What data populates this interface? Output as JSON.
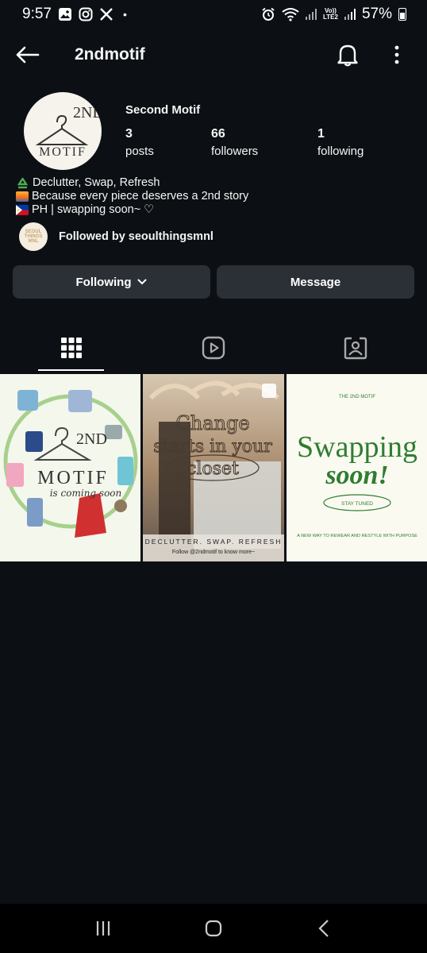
{
  "status_bar": {
    "time": "9:57",
    "dot": "•",
    "battery": "57%",
    "vo_label": "Vo))",
    "lte_label": "LTE2"
  },
  "header": {
    "username": "2ndmotif"
  },
  "profile": {
    "avatar_text": {
      "top": "2ND",
      "bottom": "MOTIF"
    },
    "display_name": "Second Motif",
    "stats": [
      {
        "num": "3",
        "label": "posts"
      },
      {
        "num": "66",
        "label": "followers"
      },
      {
        "num": "1",
        "label": "following"
      }
    ],
    "bio": [
      "Declutter, Swap, Refresh",
      "Because every piece deserves a 2nd story",
      "PH | swapping soon~ ♡"
    ],
    "followed_by": "Followed by seoulthingsmnl",
    "follower_avatar_text": "SEOUL THINGS MNL"
  },
  "buttons": {
    "following": "Following",
    "message": "Message"
  },
  "tabs": [
    "grid-icon",
    "reels-icon",
    "tagged-icon"
  ],
  "posts": [
    {
      "title_top": "2ND",
      "title_main": "MOTIF",
      "subtitle": "is coming soon"
    },
    {
      "headline": [
        "Change",
        "starts in your",
        "closet"
      ],
      "tagline": "DECLUTTER. SWAP. REFRESH",
      "footer": "Follow @2ndmotif to know more~"
    },
    {
      "small_title": "THE 2ND MOTIF",
      "headline1": "Swapping",
      "headline2": "soon!",
      "pill": "STAY TUNED",
      "footer": "A NEW WAY TO REWEAR AND RESTYLE WITH PURPOSE"
    }
  ],
  "colors": {
    "background": "#0c1014",
    "button": "#2b3036",
    "green": "#2e7d32"
  }
}
